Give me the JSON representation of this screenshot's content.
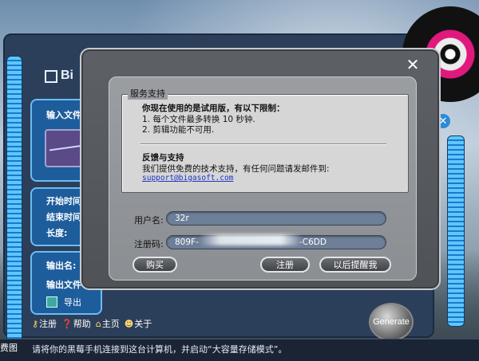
{
  "app": {
    "logo_text": "Bi",
    "panels": {
      "input_label": "输入文件",
      "start_time_label": "开始时间",
      "end_time_label": "结束时间",
      "length_label": "长度:",
      "output_name_label": "输出名:",
      "output_file_label": "输出文件",
      "export_label": "导出"
    },
    "links": [
      {
        "icon": "key-icon",
        "label": "注册"
      },
      {
        "icon": "help-icon",
        "label": "帮助"
      },
      {
        "icon": "home-icon",
        "label": "主页"
      },
      {
        "icon": "about-icon",
        "label": "关于"
      }
    ],
    "generate_label": "Generate",
    "status_text": "请将你的黑莓手机连接到这台计算机，并启动“大容量存储模式”。",
    "edge_text": "费图"
  },
  "dialog": {
    "close_symbol": "✕",
    "group_title": "服务支持",
    "trial_heading": "你现在使用的是试用版，有以下限制：",
    "limit_1": "1. 每个文件最多转换 10 秒钟.",
    "limit_2": "2. 剪辑功能不可用.",
    "feedback_heading": "反馈与支持",
    "feedback_text": "我们提供免费的技术支持，有任何问题请发邮件到:",
    "support_email": "support@bigasoft.com",
    "username_label": "用户名:",
    "username_value": "32r",
    "regcode_label": "注册码:",
    "regcode_prefix": "809F-",
    "regcode_suffix": "-C6DD",
    "buy_button": "购买",
    "register_button": "注册",
    "remind_later_button": "以后提醒我"
  },
  "colors": {
    "dialog_bg": "#5d6166",
    "field_bg": "#6e7f98",
    "link": "#1a34c2",
    "accent_blue": "#1b79c9"
  }
}
